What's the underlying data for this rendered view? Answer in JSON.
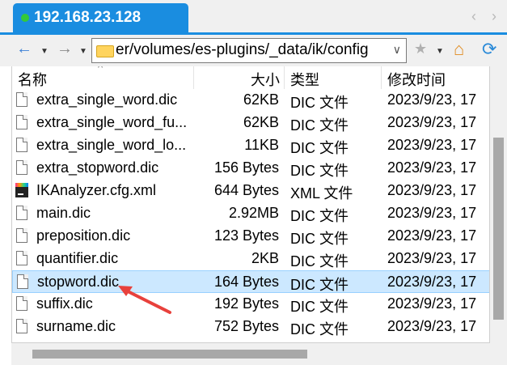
{
  "window": {
    "tab_title": "192.168.23.128",
    "nav_left": "‹",
    "nav_right": "›"
  },
  "toolbar": {
    "back_icon": "←",
    "forward_icon": "→",
    "dropdown_caret": "▼",
    "address_path": "er/volumes/es-plugins/_data/ik/config",
    "address_chevron": "∨",
    "star_icon": "★",
    "home_icon": "⌂",
    "refresh_icon": "⟳"
  },
  "columns": {
    "name": "名称",
    "size": "大小",
    "type": "类型",
    "modified": "修改时间",
    "sort_indicator": "^"
  },
  "files": [
    {
      "name": "extra_single_word.dic",
      "size": "62KB",
      "type": "DIC 文件",
      "modified": "2023/9/23, 17",
      "icon": "file-icon"
    },
    {
      "name": "extra_single_word_fu...",
      "size": "62KB",
      "type": "DIC 文件",
      "modified": "2023/9/23, 17",
      "icon": "file-icon"
    },
    {
      "name": "extra_single_word_lo...",
      "size": "11KB",
      "type": "DIC 文件",
      "modified": "2023/9/23, 17",
      "icon": "file-icon"
    },
    {
      "name": "extra_stopword.dic",
      "size": "156 Bytes",
      "type": "DIC 文件",
      "modified": "2023/9/23, 17",
      "icon": "file-icon"
    },
    {
      "name": "IKAnalyzer.cfg.xml",
      "size": "644 Bytes",
      "type": "XML 文件",
      "modified": "2023/9/23, 17",
      "icon": "xml-file-icon"
    },
    {
      "name": "main.dic",
      "size": "2.92MB",
      "type": "DIC 文件",
      "modified": "2023/9/23, 17",
      "icon": "file-icon"
    },
    {
      "name": "preposition.dic",
      "size": "123 Bytes",
      "type": "DIC 文件",
      "modified": "2023/9/23, 17",
      "icon": "file-icon"
    },
    {
      "name": "quantifier.dic",
      "size": "2KB",
      "type": "DIC 文件",
      "modified": "2023/9/23, 17",
      "icon": "file-icon"
    },
    {
      "name": "stopword.dic",
      "size": "164 Bytes",
      "type": "DIC 文件",
      "modified": "2023/9/23, 17",
      "icon": "file-icon",
      "selected": true
    },
    {
      "name": "suffix.dic",
      "size": "192 Bytes",
      "type": "DIC 文件",
      "modified": "2023/9/23, 17",
      "icon": "file-icon"
    },
    {
      "name": "surname.dic",
      "size": "752 Bytes",
      "type": "DIC 文件",
      "modified": "2023/9/23, 17",
      "icon": "file-icon"
    }
  ],
  "colors": {
    "tab_blue": "#1a8de0",
    "selection": "#cce8ff",
    "annotation_arrow": "#e8413c"
  },
  "annotation": {
    "icon": "red-arrow-icon",
    "points_to": "stopword.dic"
  }
}
